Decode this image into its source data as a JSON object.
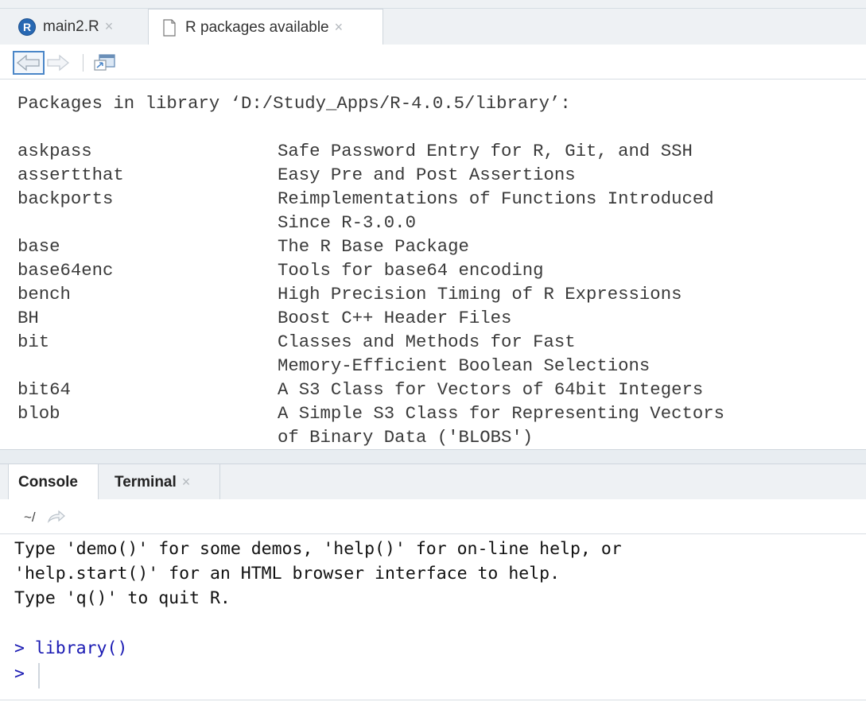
{
  "editor": {
    "tabs": [
      {
        "label": "main2.R",
        "icon": "r-file-icon",
        "close": "×",
        "active": false
      },
      {
        "label": "R packages available",
        "icon": "document-icon",
        "close": "×",
        "active": true
      }
    ]
  },
  "listing": {
    "heading": "Packages in library ‘D:/Study_Apps/R-4.0.5/library’:",
    "packages": [
      {
        "name": "askpass",
        "desc": "Safe Password Entry for R, Git, and SSH"
      },
      {
        "name": "assertthat",
        "desc": "Easy Pre and Post Assertions"
      },
      {
        "name": "backports",
        "desc": "Reimplementations of Functions Introduced",
        "desc2": "Since R-3.0.0"
      },
      {
        "name": "base",
        "desc": "The R Base Package"
      },
      {
        "name": "base64enc",
        "desc": "Tools for base64 encoding"
      },
      {
        "name": "bench",
        "desc": "High Precision Timing of R Expressions"
      },
      {
        "name": "BH",
        "desc": "Boost C++ Header Files"
      },
      {
        "name": "bit",
        "desc": "Classes and Methods for Fast",
        "desc2": "Memory-Efficient Boolean Selections"
      },
      {
        "name": "bit64",
        "desc": "A S3 Class for Vectors of 64bit Integers"
      },
      {
        "name": "blob",
        "desc": "A Simple S3 Class for Representing Vectors",
        "desc2": "of Binary Data ('BLOBS')"
      }
    ]
  },
  "console_tabs": {
    "console_label": "Console",
    "terminal_label": "Terminal",
    "terminal_close": "×"
  },
  "console": {
    "path": "~/",
    "lines": [
      "Type 'demo()' for some demos, 'help()' for on-line help, or",
      "'help.start()' for an HTML browser interface to help.",
      "Type 'q()' to quit R."
    ],
    "command": "> library()",
    "prompt": ">"
  },
  "colors": {
    "prompt_blue": "#1a1ab3",
    "r_logo": "#2768b3",
    "nav_highlight": "#4a86c8"
  }
}
